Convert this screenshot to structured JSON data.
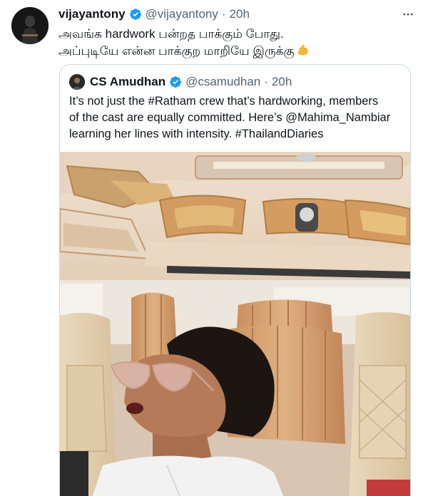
{
  "tweet": {
    "display_name": "vijayantony",
    "handle": "@vijayantony",
    "separator": "·",
    "timestamp": "20h",
    "text_lines": [
      "அவங்க hardwork பன்றத பாக்கும் போது.",
      "அப்புடியே என்ன பாக்குற மாறியே இருக்கு"
    ],
    "emoji": "flexed-biceps-icon"
  },
  "quoted_tweet": {
    "display_name": "CS Amudhan",
    "handle": "@csamudhan",
    "separator": "·",
    "timestamp": "20h",
    "text_lines": [
      "It’s not just the #Ratham crew that’s hardworking, members",
      "of the cast are equally committed. Here’s @Mahima_Nambiar",
      "learning her lines with intensity. #ThailandDiaries"
    ],
    "media": "photo-woman-in-van"
  },
  "colors": {
    "text": "#0f1419",
    "secondary": "#536471",
    "verified": "#1d9bf0",
    "border": "#cfd9de"
  }
}
